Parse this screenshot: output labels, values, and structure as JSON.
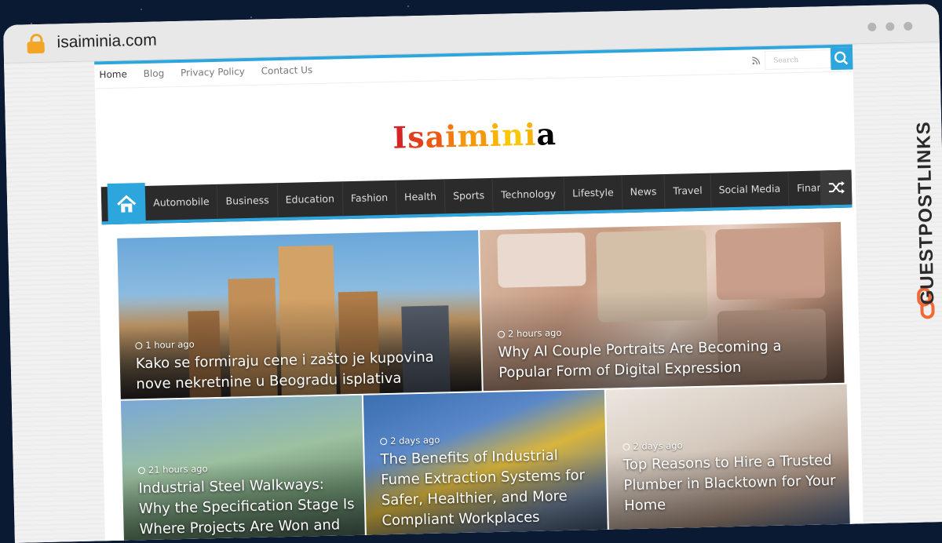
{
  "browser": {
    "url": "isaiminia.com"
  },
  "topbar": {
    "links": [
      "Home",
      "Blog",
      "Privacy Policy",
      "Contact Us"
    ],
    "search_placeholder": "Search"
  },
  "site": {
    "logo_letters": [
      "I",
      "s",
      "a",
      "i",
      "m",
      "i",
      "n",
      "i",
      "a"
    ]
  },
  "nav": {
    "items": [
      "Automobile",
      "Business",
      "Education",
      "Fashion",
      "Health",
      "Sports",
      "Technology",
      "Lifestyle",
      "News",
      "Travel",
      "Social Media",
      "Finance"
    ]
  },
  "articles": [
    {
      "time": "1 hour ago",
      "title": "Kako se formiraju cene i zašto je kupovina nove nekretnine u Beogradu isplativa"
    },
    {
      "time": "2 hours ago",
      "title": "Why AI Couple Portraits Are Becoming a Popular Form of Digital Expression"
    },
    {
      "time": "21 hours ago",
      "title": "Industrial Steel Walkways: Why the Specification Stage Is Where Projects Are Won and Lost"
    },
    {
      "time": "2 days ago",
      "title": "The Benefits of Industrial Fume Extraction Systems for Safer, Healthier, and More Compliant Workplaces"
    },
    {
      "time": "2 days ago",
      "title": "Top Reasons to Hire a Trusted Plumber in Blacktown for Your Home"
    }
  ],
  "watermark": {
    "text": "GUESTPOSTLINKS"
  },
  "colors": {
    "accent": "#2da5dd",
    "nav_bg": "#2b2b2b",
    "lock": "#f3a626"
  }
}
